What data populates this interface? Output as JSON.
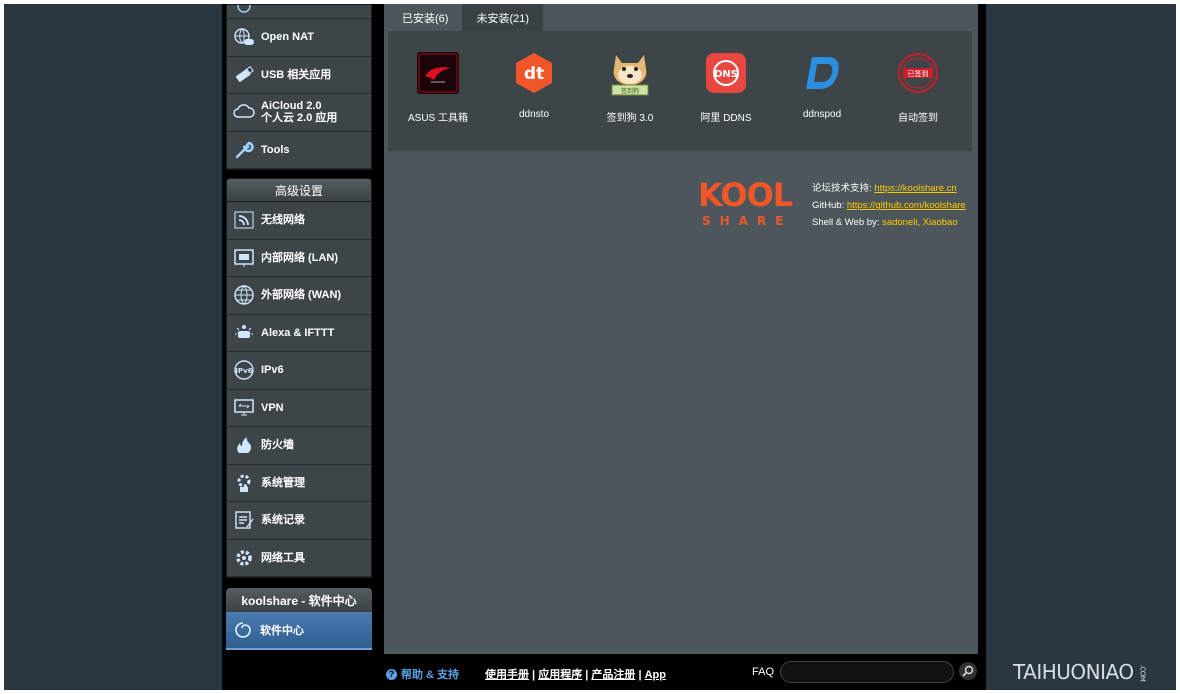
{
  "sidebar": {
    "top_items": [
      {
        "label": "Open NAT",
        "icon": "gamepad-globe-icon"
      },
      {
        "label": "USB 相关应用",
        "icon": "usb-icon"
      },
      {
        "label_line1": "AiCloud 2.0",
        "label_line2": "个人云 2.0 应用",
        "icon": "cloud-icon"
      },
      {
        "label": "Tools",
        "icon": "wrench-icon"
      }
    ],
    "advanced_header": "高级设置",
    "advanced_items": [
      {
        "label": "无线网络",
        "icon": "wireless-icon"
      },
      {
        "label": "内部网络 (LAN)",
        "icon": "lan-icon"
      },
      {
        "label": "外部网络 (WAN)",
        "icon": "globe-icon"
      },
      {
        "label": "Alexa & IFTTT",
        "icon": "alexa-icon"
      },
      {
        "label": "IPv6",
        "icon": "ipv6-icon"
      },
      {
        "label": "VPN",
        "icon": "vpn-icon"
      },
      {
        "label": "防火墙",
        "icon": "firewall-icon"
      },
      {
        "label": "系统管理",
        "icon": "system-admin-icon"
      },
      {
        "label": "系统记录",
        "icon": "system-log-icon"
      },
      {
        "label": "网络工具",
        "icon": "network-tools-icon"
      }
    ],
    "koolshare_header": "koolshare - 软件中心",
    "koolshare_item": "软件中心"
  },
  "tabs": {
    "installed": "已安装(6)",
    "not_installed": "未安装(21)"
  },
  "apps": [
    {
      "name": "ASUS 工具箱",
      "icon": "rog-icon"
    },
    {
      "name": "ddnsto",
      "icon": "ddnsto-icon"
    },
    {
      "name": "签到狗 3.0",
      "icon": "doge-icon"
    },
    {
      "name": "阿里 DDNS",
      "icon": "dns-icon"
    },
    {
      "name": "ddnspod",
      "icon": "ddnspod-icon"
    },
    {
      "name": "自动签到",
      "icon": "stamp-icon"
    }
  ],
  "logo": {
    "top": "KOOL",
    "bottom": "SHARE"
  },
  "credits": {
    "forum_label": "论坛技术支持: ",
    "forum_link": "https://koolshare.cn",
    "github_label": "GitHub: ",
    "github_link": "https://github.com/koolshare",
    "shell_label": "Shell & Web by: ",
    "author1": "sadoneli",
    "sep": ", ",
    "author2": "Xiaobao"
  },
  "footer": {
    "help": "帮助 & 支持",
    "manual": "使用手册",
    "utility": "应用程序",
    "register": "产品注册",
    "app": "App",
    "faq": "FAQ",
    "faq_placeholder": ""
  },
  "watermark": {
    "text": "TAIHUONIAO",
    "suffix": ".COM"
  },
  "colors": {
    "accent_yellow": "#ffcc00",
    "link_blue": "#5aa0e6",
    "koolshare_orange": "#f0562a"
  }
}
